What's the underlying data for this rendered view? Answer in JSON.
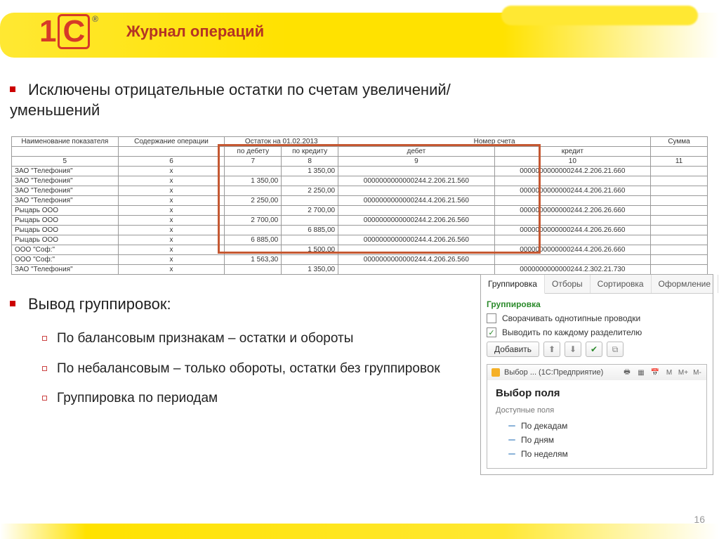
{
  "header": {
    "title": "Журнал операций",
    "logo_1": "1",
    "logo_c": "C",
    "reg": "®"
  },
  "bullets": {
    "b1": "Исключены отрицательные остатки по счетам увеличений/уменьшений",
    "b2": "Вывод группировок:",
    "subs": [
      "По балансовым признакам – остатки и обороты",
      "По небалансовым – только обороты, остатки без группировок",
      "Группировка по периодам"
    ]
  },
  "table": {
    "headers_top": [
      "Наименование показателя",
      "Содержание операции",
      "Остаток на 01.02.2013",
      "",
      "Номер счета",
      "",
      "Сумма"
    ],
    "headers_sub": [
      "",
      "",
      "по дебету",
      "по кредиту",
      "дебет",
      "кредит",
      ""
    ],
    "nums": [
      "5",
      "6",
      "7",
      "8",
      "9",
      "10",
      "11"
    ],
    "rows": [
      [
        "ЗАО \"Телефония\"",
        "x",
        "",
        "1 350,00",
        "",
        "0000000000000244.2.206.21.660",
        ""
      ],
      [
        "ЗАО \"Телефония\"",
        "x",
        "1 350,00",
        "",
        "0000000000000244.2.206.21.560",
        "",
        ""
      ],
      [
        "ЗАО \"Телефония\"",
        "x",
        "",
        "2 250,00",
        "",
        "0000000000000244.4.206.21.660",
        ""
      ],
      [
        "ЗАО \"Телефония\"",
        "x",
        "2 250,00",
        "",
        "0000000000000244.4.206.21.560",
        "",
        ""
      ],
      [
        "Рыцарь ООО",
        "x",
        "",
        "2 700,00",
        "",
        "0000000000000244.2.206.26.660",
        ""
      ],
      [
        "Рыцарь ООО",
        "x",
        "2 700,00",
        "",
        "0000000000000244.2.206.26.560",
        "",
        ""
      ],
      [
        "Рыцарь ООО",
        "x",
        "",
        "6 885,00",
        "",
        "0000000000000244.4.206.26.660",
        ""
      ],
      [
        "Рыцарь ООО",
        "x",
        "6 885,00",
        "",
        "0000000000000244.4.206.26.560",
        "",
        ""
      ],
      [
        "ООО \"Соф:\"",
        "x",
        "",
        "1 500,00",
        "",
        "0000000000000244.4.206.26.660",
        ""
      ],
      [
        "ООО \"Соф:\"",
        "x",
        "1 563,30",
        "",
        "0000000000000244.4.206.26.560",
        "",
        ""
      ],
      [
        "ЗАО \"Телефония\"",
        "x",
        "",
        "1 350,00",
        "",
        "0000000000000244.2.302.21.730",
        ""
      ]
    ]
  },
  "panel": {
    "tabs": [
      "Группировка",
      "Отборы",
      "Сортировка",
      "Оформление"
    ],
    "group_title": "Группировка",
    "chk1": "Сворачивать однотипные проводки",
    "chk2": "Выводить по каждому разделителю",
    "add": "Добавить",
    "subwin_title": "Выбор ... (1С:Предприятие)",
    "subwin_m": [
      "M",
      "M+",
      "M-"
    ],
    "subwin_heading": "Выбор поля",
    "avail": "Доступные поля",
    "fields": [
      "По декадам",
      "По дням",
      "По неделям"
    ]
  },
  "pagenum": "16"
}
